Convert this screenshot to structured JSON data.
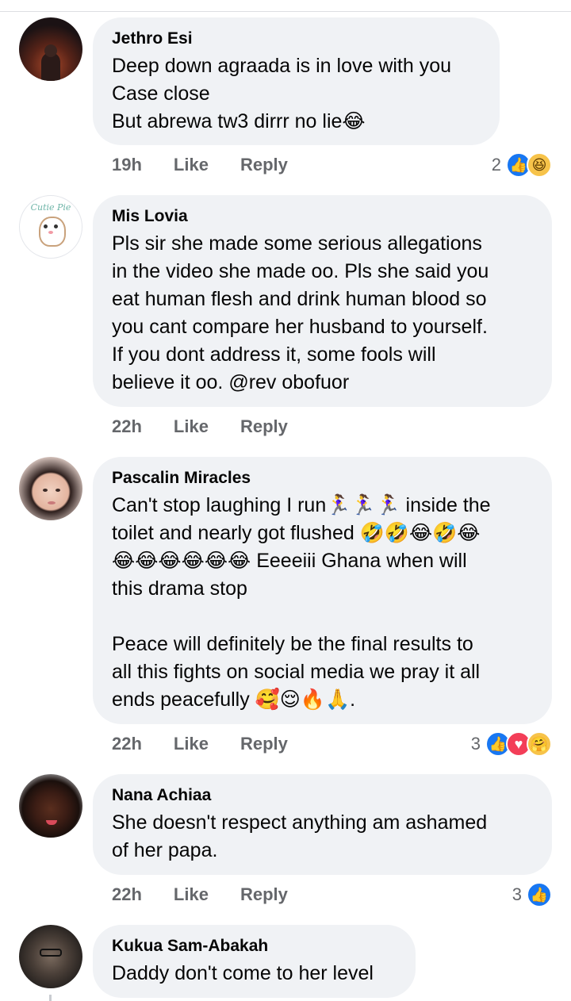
{
  "comments": [
    {
      "author": "Jethro Esi",
      "text": "Deep down agraada is in love with you\nCase close\nBut abrewa tw3 dirrr no lie😂",
      "time": "19h",
      "like_label": "Like",
      "reply_label": "Reply",
      "reaction_count": "2",
      "reactions": [
        "like",
        "laugh"
      ]
    },
    {
      "author": "Mis Lovia",
      "text": "Pls sir she made some serious allegations\nin the video she made oo. Pls she said you\neat human flesh and drink human blood so\nyou cant compare her husband to yourself.\nIf you dont address it, some fools will\nbelieve it oo. @rev obofuor",
      "time": "22h",
      "like_label": "Like",
      "reply_label": "Reply",
      "avatar_text": "Cutie Pie"
    },
    {
      "author": "Pascalin Miracles",
      "text": "Can't stop laughing I run🏃‍♀️🏃‍♀️🏃‍♀️ inside the\ntoilet and nearly got flushed 🤣🤣😂🤣😂\n😂😂😂😂😂😂 Eeeeiii Ghana when will\nthis drama stop\n\nPeace will definitely be the final results to\nall this fights on social media we pray it all\nends peacefully 🥰😌🔥🙏.",
      "time": "22h",
      "like_label": "Like",
      "reply_label": "Reply",
      "reaction_count": "3",
      "reactions": [
        "like",
        "heart",
        "care"
      ]
    },
    {
      "author": "Nana Achiaa",
      "text": "She doesn't respect anything am ashamed\nof her papa.",
      "time": "22h",
      "like_label": "Like",
      "reply_label": "Reply",
      "reaction_count": "3",
      "reactions": [
        "like"
      ]
    },
    {
      "author": "Kukua Sam-Abakah",
      "text": "Daddy don't come to her level"
    }
  ],
  "colors": {
    "bubble": "#f0f2f5",
    "meta_text": "#65676b",
    "like_blue": "#1877f2",
    "heart_red": "#f33e58",
    "emoji_yellow": "#f7c34a"
  }
}
